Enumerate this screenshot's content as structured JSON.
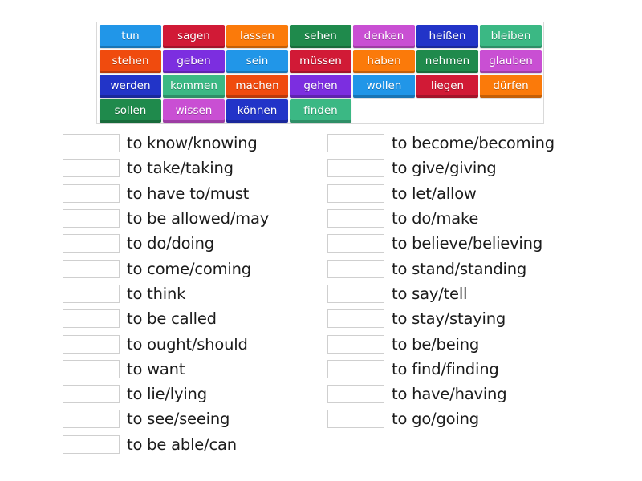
{
  "word_bank": {
    "tiles": [
      {
        "word": "tun",
        "color": "blue"
      },
      {
        "word": "sagen",
        "color": "red"
      },
      {
        "word": "lassen",
        "color": "orange"
      },
      {
        "word": "sehen",
        "color": "green"
      },
      {
        "word": "denken",
        "color": "pink"
      },
      {
        "word": "heißen",
        "color": "navy"
      },
      {
        "word": "bleiben",
        "color": "teal"
      },
      {
        "word": "stehen",
        "color": "redorange"
      },
      {
        "word": "geben",
        "color": "purple"
      },
      {
        "word": "sein",
        "color": "blue"
      },
      {
        "word": "müssen",
        "color": "red"
      },
      {
        "word": "haben",
        "color": "orange"
      },
      {
        "word": "nehmen",
        "color": "green"
      },
      {
        "word": "glauben",
        "color": "pink"
      },
      {
        "word": "werden",
        "color": "navy"
      },
      {
        "word": "kommen",
        "color": "teal"
      },
      {
        "word": "machen",
        "color": "redorange"
      },
      {
        "word": "gehen",
        "color": "purple"
      },
      {
        "word": "wollen",
        "color": "blue"
      },
      {
        "word": "liegen",
        "color": "red"
      },
      {
        "word": "dürfen",
        "color": "orange"
      },
      {
        "word": "sollen",
        "color": "green"
      },
      {
        "word": "wissen",
        "color": "pink"
      },
      {
        "word": "können",
        "color": "navy"
      },
      {
        "word": "finden",
        "color": "teal"
      }
    ]
  },
  "colors": {
    "blue": "#2196e8",
    "red": "#d11a36",
    "orange": "#fb7a0a",
    "green": "#1f8a4c",
    "pink": "#c94fd3",
    "navy": "#2234c8",
    "teal": "#3bb884",
    "redorange": "#f04b0e",
    "purple": "#7c2ee0"
  },
  "clues_left": [
    {
      "answer": "",
      "clue": "to know/knowing"
    },
    {
      "answer": "",
      "clue": "to take/taking"
    },
    {
      "answer": "",
      "clue": "to have to/must"
    },
    {
      "answer": "",
      "clue": "to be allowed/may"
    },
    {
      "answer": "",
      "clue": "to do/doing"
    },
    {
      "answer": "",
      "clue": "to come/coming"
    },
    {
      "answer": "",
      "clue": "to think"
    },
    {
      "answer": "",
      "clue": "to be called"
    },
    {
      "answer": "",
      "clue": "to ought/should"
    },
    {
      "answer": "",
      "clue": "to want"
    },
    {
      "answer": "",
      "clue": "to lie/lying"
    },
    {
      "answer": "",
      "clue": "to see/seeing"
    },
    {
      "answer": "",
      "clue": "to be able/can"
    }
  ],
  "clues_right": [
    {
      "answer": "",
      "clue": "to become/becoming"
    },
    {
      "answer": "",
      "clue": "to give/giving"
    },
    {
      "answer": "",
      "clue": "to let/allow"
    },
    {
      "answer": "",
      "clue": "to do/make"
    },
    {
      "answer": "",
      "clue": "to believe/believing"
    },
    {
      "answer": "",
      "clue": "to stand/standing"
    },
    {
      "answer": "",
      "clue": "to say/tell"
    },
    {
      "answer": "",
      "clue": "to stay/staying"
    },
    {
      "answer": "",
      "clue": "to be/being"
    },
    {
      "answer": "",
      "clue": "to find/finding"
    },
    {
      "answer": "",
      "clue": "to have/having"
    },
    {
      "answer": "",
      "clue": "to go/going"
    }
  ]
}
